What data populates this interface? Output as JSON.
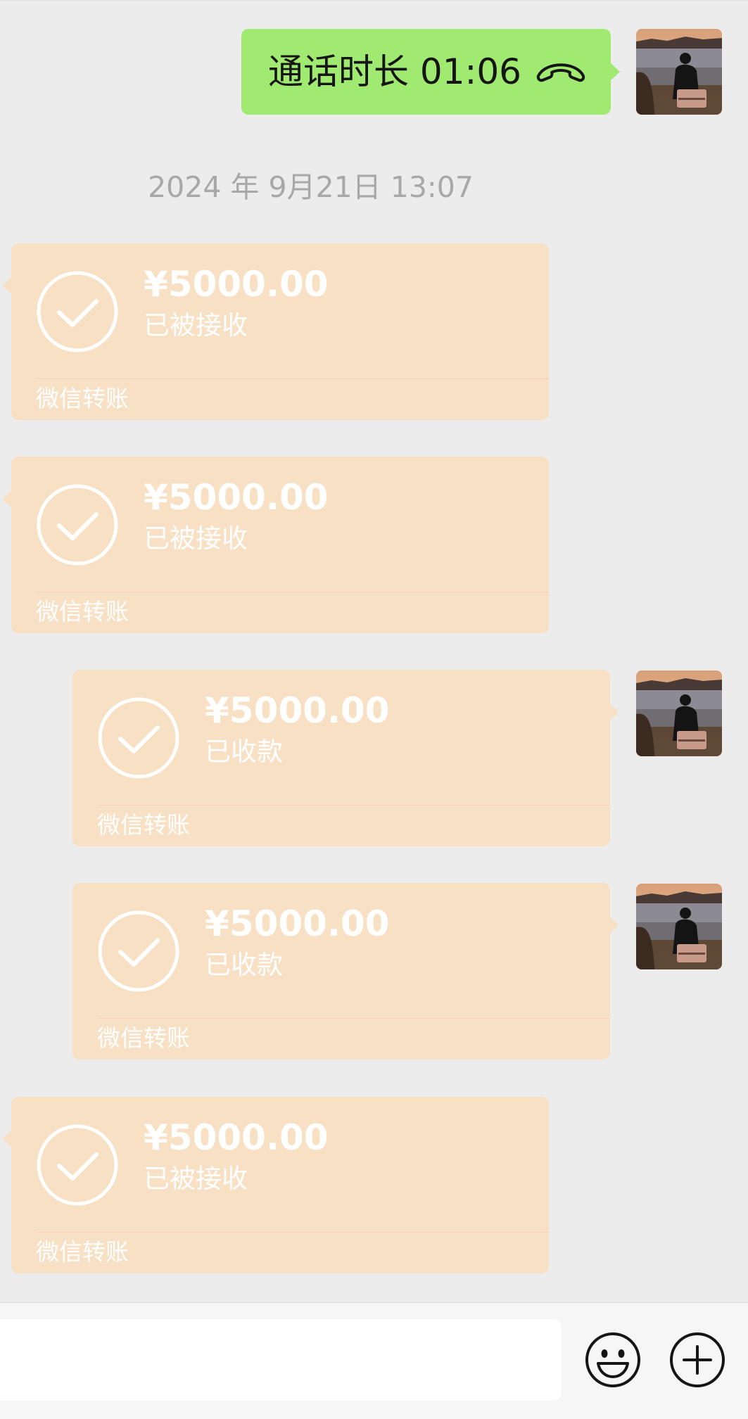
{
  "call": {
    "text": "通话时长 01:06",
    "icon": "phone-hangup-icon"
  },
  "timestamp": "2024 年 9月21日 13:07",
  "transfers": [
    {
      "side": "left",
      "amount": "¥5000.00",
      "status": "已被接收",
      "source": "微信转账",
      "icon": "check-circle-icon"
    },
    {
      "side": "left",
      "amount": "¥5000.00",
      "status": "已被接收",
      "source": "微信转账",
      "icon": "check-circle-icon"
    },
    {
      "side": "right",
      "amount": "¥5000.00",
      "status": "已收款",
      "source": "微信转账",
      "icon": "check-circle-icon"
    },
    {
      "side": "right",
      "amount": "¥5000.00",
      "status": "已收款",
      "source": "微信转账",
      "icon": "check-circle-icon"
    },
    {
      "side": "left",
      "amount": "¥5000.00",
      "status": "已被接收",
      "source": "微信转账",
      "icon": "check-circle-icon"
    }
  ],
  "input_bar": {
    "value": "",
    "placeholder": "",
    "icons": [
      "emoji-icon",
      "plus-circle-icon"
    ]
  },
  "colors": {
    "chat_background": "#ececec",
    "call_bubble": "#a0ea72",
    "transfer_bubble": "#f8e0c4",
    "timestamp_text": "#a8a8a8"
  }
}
